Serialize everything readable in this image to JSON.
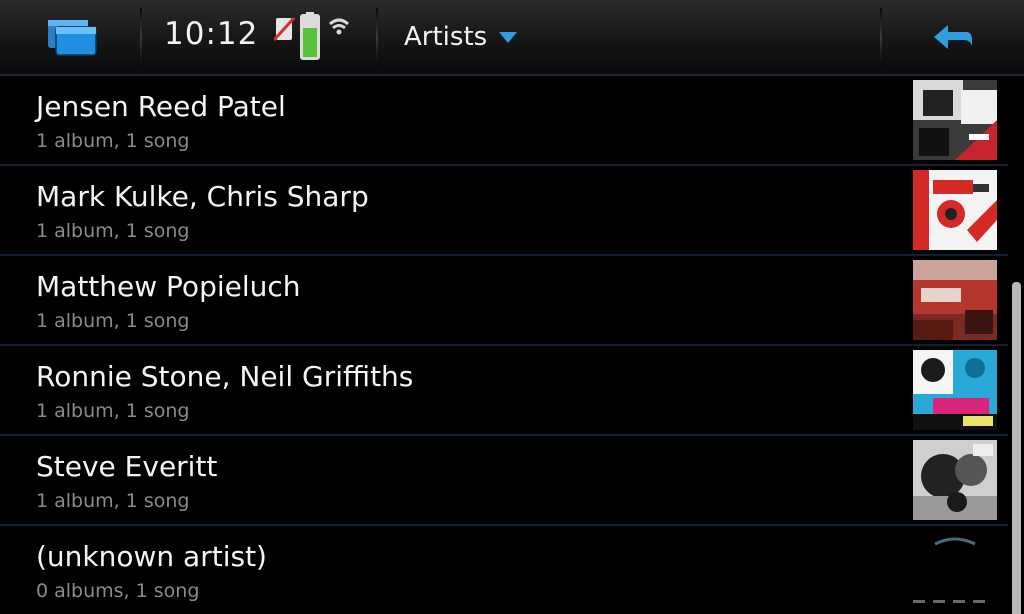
{
  "topbar": {
    "time": "10:12",
    "view_label": "Artists"
  },
  "icons": {
    "task_switcher": "task-switcher-icon",
    "battery": "battery-icon",
    "wifi": "wifi-icon",
    "back": "back-arrow-icon"
  },
  "colors": {
    "accent": "#2f9ee0",
    "background": "#000000",
    "divider": "#102030"
  },
  "artists": [
    {
      "name": "Jensen Reed Patel",
      "details": "1 album, 1 song"
    },
    {
      "name": "Mark Kulke, Chris Sharp",
      "details": "1 album, 1 song"
    },
    {
      "name": "Matthew Popieluch",
      "details": "1 album, 1 song"
    },
    {
      "name": "Ronnie Stone, Neil Griffiths",
      "details": "1 album, 1 song"
    },
    {
      "name": "Steve Everitt",
      "details": "1 album, 1 song"
    },
    {
      "name": "(unknown artist)",
      "details": "0 albums, 1 song"
    }
  ]
}
